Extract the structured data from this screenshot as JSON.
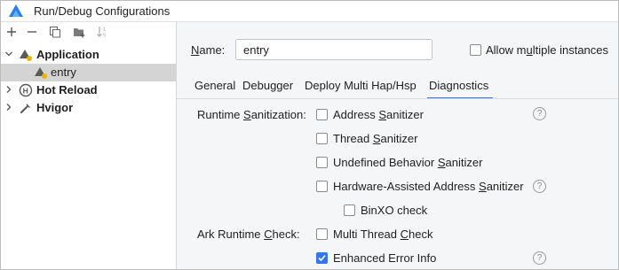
{
  "window": {
    "title": "Run/Debug Configurations"
  },
  "toolbar": {
    "add": "+",
    "remove": "−"
  },
  "tree": {
    "application": "Application",
    "entry": "entry",
    "hot_reload": "Hot Reload",
    "hvigor": "Hvigor"
  },
  "form": {
    "name_label": "Name:",
    "name_value": "entry",
    "allow_multiple": "Allow multiple instances",
    "allow_multiple_checked": false
  },
  "tabs": [
    "General",
    "Debugger",
    "Deploy Multi Hap/Hsp",
    "Diagnostics"
  ],
  "active_tab": "Diagnostics",
  "diagnostics": {
    "runtime_label": "Runtime Sanitization:",
    "address": "Address Sanitizer",
    "thread": "Thread Sanitizer",
    "undefined": "Undefined Behavior Sanitizer",
    "hwasan": "Hardware-Assisted Address Sanitizer",
    "binxo": "BinXO check",
    "ark_label": "Ark Runtime Check:",
    "multi_thread": "Multi Thread Check",
    "enhanced": "Enhanced Error Info",
    "enhanced_checked": true
  },
  "help": "?",
  "colors": {
    "accent": "#3574f0"
  }
}
